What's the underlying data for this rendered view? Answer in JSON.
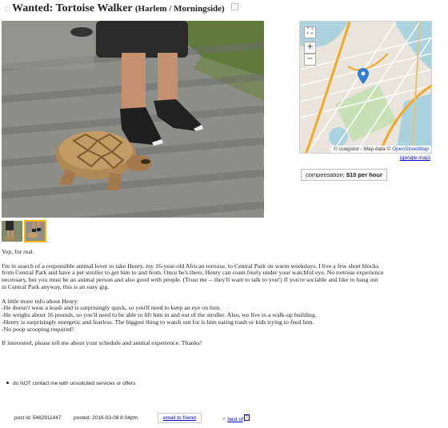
{
  "title": {
    "main": "Wanted: Tortoise Walker",
    "location": "(Harlem / Morningside)"
  },
  "map": {
    "attribution_prefix": "© craigslist - Map data ©",
    "attribution_link": "OpenStreetMap",
    "google_maps_label": "(google map)"
  },
  "compensation": {
    "label": "compensation:",
    "value": "$10 per hour"
  },
  "body": {
    "greeting": "Yep, for real.",
    "para1": [
      "I'm in search of a responsible animal lover to take Henry, my 16-year-old African tortoise, to Central Park on warm weekdays. I live a few short blocks",
      "from Central Park and have a pet stroller to get him to and from. Once he's there, Henry can roam freely under your watchful eye. No tortoise experience",
      "necessary, but you must be an animal person and also good with people. (Trust me -- they'll want to talk to you!) If you're sociable and like to hang out",
      "in Central Park anyway, this is an easy gig."
    ],
    "para2": [
      "A little more info about Henry:",
      "-He doesn't wear a leash and is surprisingly quick, so you'll need to keep an eye on him.",
      "-He weighs about 16 pounds, so you'll need to be able to lift him in and out of the stroller. Also, we live in a walk-up building.",
      "-Henry is surprisingly energetic and fearless. The biggest thing to watch out for is him eating trash or kids trying to feed him.",
      "-No poop scooping required!"
    ],
    "closing": "If interested, please tell me about your schedule and animal experience. Thanks!"
  },
  "notices": [
    "do NOT contact me with unsolicited services or offers"
  ],
  "footer": {
    "post_id": "post id: 5482911447",
    "posted": "posted: 2016-03-08 8:04pm",
    "email_label": "email to friend",
    "best_of_label": "best of",
    "best_of_help": "?"
  },
  "icons": {
    "favorite": "star-icon",
    "hide": "trash-icon",
    "fullscreen": "fullscreen-icon",
    "map_pin": "map-pin-icon",
    "best_of": "heart-icon"
  },
  "colors": {
    "link": "#0000cc",
    "selected_thumb": "#ffb400",
    "map_pin": "#2b7fd6"
  }
}
